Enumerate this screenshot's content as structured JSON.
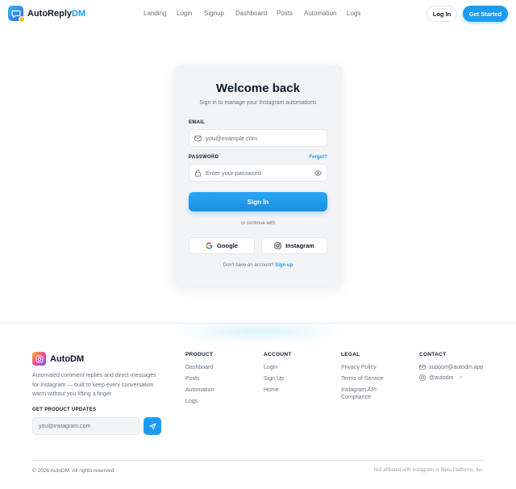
{
  "header": {
    "brand_main": "AutoReply",
    "brand_accent": "DM",
    "nav": [
      "Landing",
      "Login",
      "Signup",
      "Dashboard",
      "Posts",
      "Automation",
      "Logs"
    ],
    "login_label": "Log In",
    "cta_label": "Get Started"
  },
  "login_card": {
    "title": "Welcome back",
    "subtitle": "Sign in to manage your Instagram automations",
    "email_label": "EMAIL",
    "email_placeholder": "you@example.com",
    "password_label": "PASSWORD",
    "forgot_label": "Forgot?",
    "password_placeholder": "Enter your password",
    "signin_label": "Sign In",
    "divider_text": "or continue with",
    "google_label": "Google",
    "instagram_label": "Instagram",
    "no_account_text": "Don't have an account?",
    "signup_link": "Sign up"
  },
  "footer": {
    "brand": "AutoDM",
    "description": "Automated comment replies and direct messages for Instagram — built to keep every conversation warm without you lifting a finger.",
    "updates_label": "GET PRODUCT UPDATES",
    "updates_placeholder": "you@instagram.com",
    "columns": [
      {
        "heading": "PRODUCT",
        "links": [
          "Dashboard",
          "Posts",
          "Automation",
          "Logs"
        ]
      },
      {
        "heading": "ACCOUNT",
        "links": [
          "Login",
          "Sign Up",
          "Home"
        ]
      },
      {
        "heading": "LEGAL",
        "links": [
          "Privacy Policy",
          "Terms of Service",
          "Instagram API Compliance"
        ]
      }
    ],
    "contact": {
      "heading": "CONTACT",
      "email": "support@autodm.app",
      "handle": "@autodm",
      "handle_suffix": "↗"
    },
    "copyright": "© 2026 AutoDM. All rights reserved.",
    "disclaimer": "Not affiliated with Instagram or Meta Platforms, Inc."
  },
  "colors": {
    "accent": "#1d9bf0",
    "card_bg": "#f3f4f6",
    "muted_text": "#6b7280"
  }
}
